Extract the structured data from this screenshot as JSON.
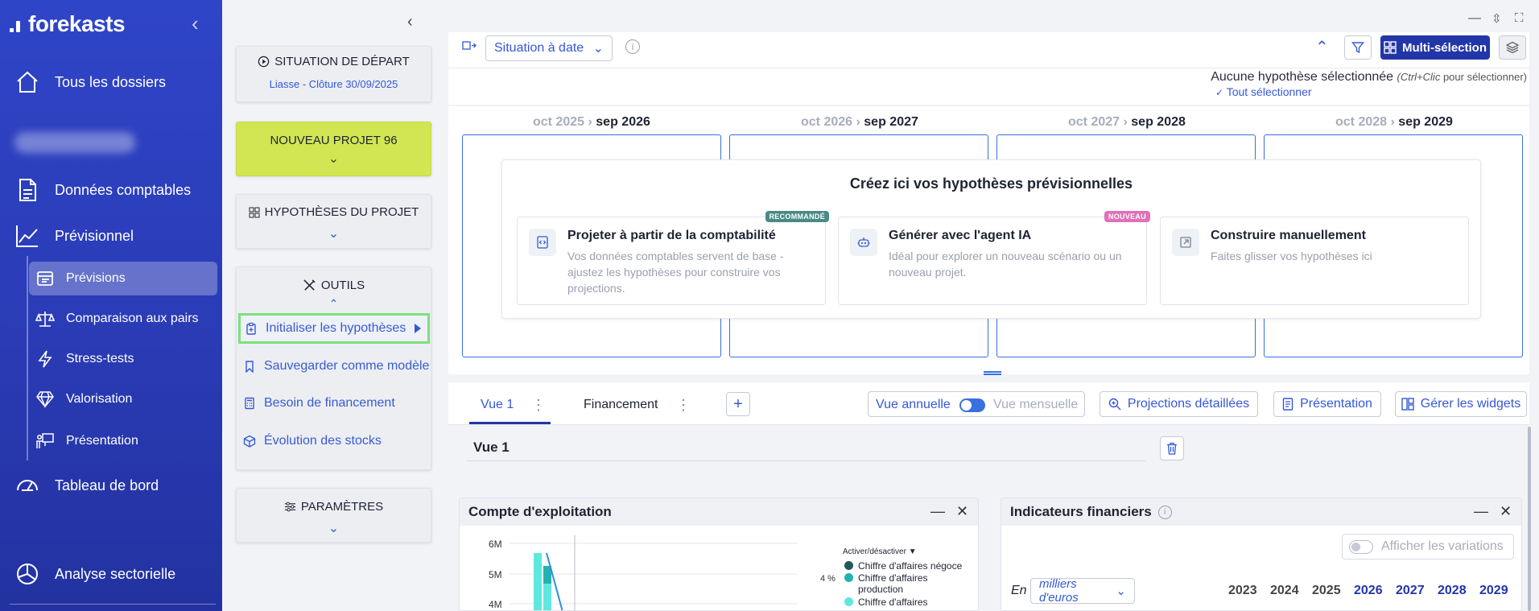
{
  "sidebar": {
    "brand": "forekasts",
    "collapse_icon": "chevron-left-icon",
    "items": [
      {
        "label": "Tous les dossiers",
        "icon": "home-icon"
      },
      {
        "label": "Données comptables",
        "icon": "document-icon"
      },
      {
        "label": "Prévisionnel",
        "icon": "trend-line-icon"
      },
      {
        "label": "Tableau de bord",
        "icon": "gauge-icon"
      },
      {
        "label": "Analyse sectorielle",
        "icon": "pie-chart-icon"
      }
    ],
    "sub_items": [
      {
        "label": "Prévisions",
        "icon": "forecast-table-icon",
        "active": true
      },
      {
        "label": "Comparaison aux pairs",
        "icon": "balance-scale-icon"
      },
      {
        "label": "Stress-tests",
        "icon": "lightning-icon"
      },
      {
        "label": "Valorisation",
        "icon": "diamond-icon"
      },
      {
        "label": "Présentation",
        "icon": "presentation-icon"
      }
    ]
  },
  "panel": {
    "situation": {
      "title": "SITUATION DE DÉPART",
      "subtitle": "Liasse - Clôture 30/09/2025"
    },
    "project": {
      "title": "NOUVEAU PROJET 96"
    },
    "hypotheses": {
      "title": "HYPOTHÈSES DU PROJET"
    },
    "tools": {
      "title": "OUTILS",
      "items": [
        {
          "label": "Initialiser les hypothèses",
          "highlighted": true
        },
        {
          "label": "Sauvegarder comme modèle"
        },
        {
          "label": "Besoin de financement"
        },
        {
          "label": "Évolution des stocks"
        }
      ]
    },
    "params": {
      "title": "PARAMÈTRES"
    }
  },
  "toolbar": {
    "view_select": "Situation à date",
    "multi_label": "Multi-sélection",
    "hint_main": "Aucune hypothèse sélectionnée",
    "hint_shortcut": "(Ctrl+Clic",
    "hint_tail": " pour sélectionner)",
    "select_all": "Tout sélectionner"
  },
  "periods": [
    {
      "from": "oct 2025",
      "to": "sep 2026"
    },
    {
      "from": "oct 2026",
      "to": "sep 2027"
    },
    {
      "from": "oct 2027",
      "to": "sep 2028"
    },
    {
      "from": "oct 2028",
      "to": "sep 2029"
    }
  ],
  "create": {
    "title": "Créez ici vos hypothèses prévisionnelles",
    "options": [
      {
        "title": "Projeter à partir de la comptabilité",
        "desc": "Vos données comptables servent de base - ajustez les hypothèses pour construire vos projections.",
        "badge": "RECOMMANDÉ",
        "badge_color": "#4a8a86"
      },
      {
        "title": "Générer avec l'agent IA",
        "desc": "Idéal pour explorer un nouveau scénario ou un nouveau projet.",
        "badge": "NOUVEAU",
        "badge_color": "#e070b8"
      },
      {
        "title": "Construire manuellement",
        "desc": "Faites glisser vos hypothèses ici",
        "badge": "",
        "badge_color": ""
      }
    ]
  },
  "tabs": {
    "items": [
      "Vue 1",
      "Financement"
    ],
    "toggle_annual": "Vue annuelle",
    "toggle_monthly": "Vue mensuelle",
    "actions": [
      "Projections détaillées",
      "Présentation",
      "Gérer les widgets"
    ]
  },
  "view": {
    "title": "Vue 1"
  },
  "widget_exploit": {
    "title": "Compte d'exploitation",
    "y_ticks": [
      "6M",
      "5M",
      "4M"
    ],
    "legend_title": "Activer/désactiver",
    "pct_label": "4 %",
    "legend": [
      {
        "label": "Chiffre d'affaires négoce",
        "color": "#1f5a55"
      },
      {
        "label": "Chiffre d'affaires production",
        "color": "#22b3b0"
      },
      {
        "label": "Chiffre d'affaires",
        "color": "#5ee8e0"
      }
    ]
  },
  "chart_data": {
    "type": "bar",
    "categories": [],
    "series": [
      {
        "name": "Chiffre d'affaires négoce",
        "values": []
      },
      {
        "name": "Chiffre d'affaires production",
        "values": []
      },
      {
        "name": "Chiffre d'affaires",
        "values": []
      }
    ],
    "y_tick_labels": [
      "6M",
      "5M",
      "4M"
    ],
    "legend_position": "right"
  },
  "widget_indic": {
    "title": "Indicateurs financiers",
    "variations": "Afficher les variations",
    "unit_prefix": "En",
    "unit": "milliers d'euros",
    "years_past": [
      "2023",
      "2024",
      "2025"
    ],
    "years_future": [
      "2026",
      "2027",
      "2028",
      "2029"
    ]
  }
}
